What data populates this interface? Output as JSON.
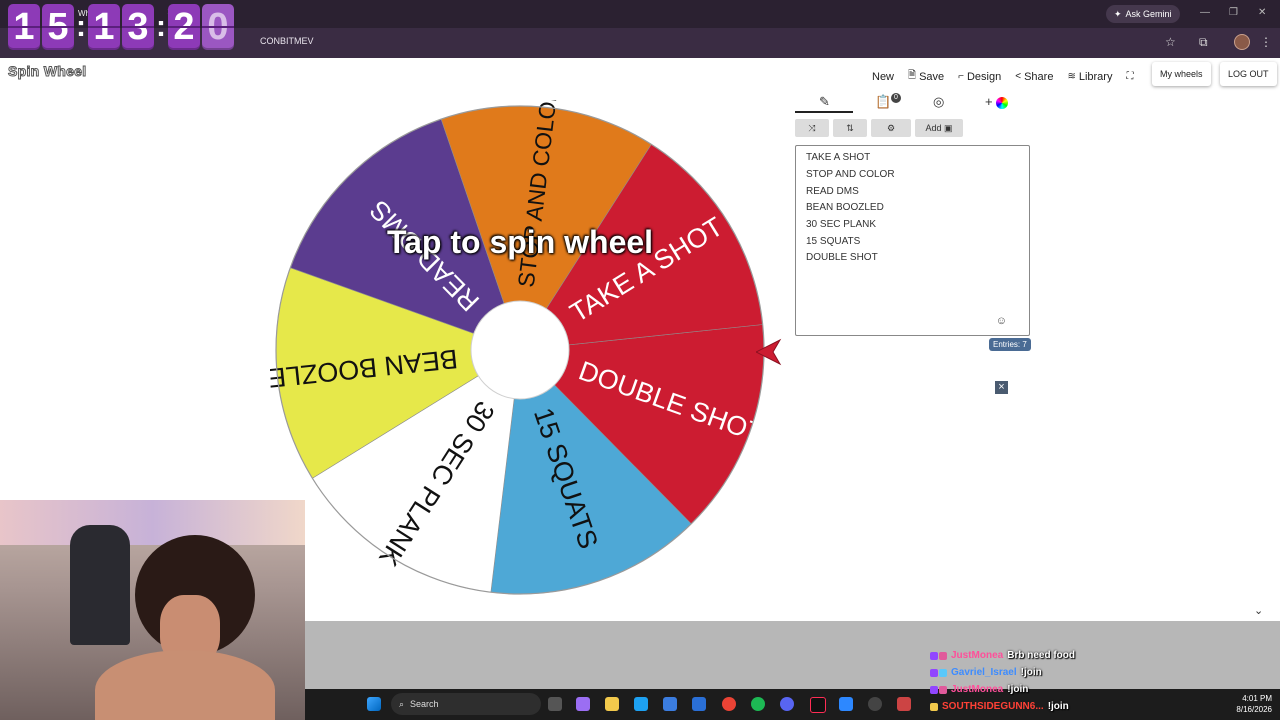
{
  "browser": {
    "tab_title": "Whee",
    "url_fragment": "CONBITMEV",
    "ask_gemini": "Ask Gemini",
    "window_controls": [
      "minimize-icon",
      "restore-icon",
      "close-icon"
    ]
  },
  "timer": {
    "digits": [
      "1",
      "5",
      "1",
      "3",
      "2",
      "0"
    ],
    "separator": ":"
  },
  "app": {
    "logo": "Spin Wheel",
    "nav": [
      {
        "label": "New",
        "icon": ""
      },
      {
        "label": "Save",
        "icon": "save-icon"
      },
      {
        "label": "Design",
        "icon": "design-icon"
      },
      {
        "label": "Share",
        "icon": "share-icon"
      },
      {
        "label": "Library",
        "icon": "library-icon"
      }
    ],
    "fullscreen_icon": "fullscreen-icon",
    "my_wheels": "My wheels",
    "logout": "LOG OUT"
  },
  "wheel": {
    "cta": "Tap to spin wheel",
    "segments": [
      {
        "label": "DOUBLE SHOT",
        "color": "#cc1c31",
        "text_color": "#ffffff"
      },
      {
        "label": "15 SQUATS",
        "color": "#4ea8d6",
        "text_color": "#111111"
      },
      {
        "label": "30 SEC PLANK",
        "color": "#ffffff",
        "text_color": "#111111"
      },
      {
        "label": "BEAN BOOZLED",
        "color": "#e6e84a",
        "text_color": "#111111"
      },
      {
        "label": "READ DMS",
        "color": "#5b3c8f",
        "text_color": "#ffffff"
      },
      {
        "label": "STOP AND COLOR",
        "color": "#e07a1b",
        "text_color": "#111111"
      },
      {
        "label": "TAKE A SHOT",
        "color": "#cc1c31",
        "text_color": "#ffffff"
      }
    ],
    "pointer_color": "#cc1c31"
  },
  "editor": {
    "tabs": [
      "edit-icon",
      "results-icon",
      "hide-icon",
      "add-color-icon"
    ],
    "results_badge": "0",
    "tools": [
      {
        "icon": "shuffle-icon",
        "label": ""
      },
      {
        "icon": "sort-icon",
        "label": ""
      },
      {
        "icon": "settings-icon",
        "label": ""
      },
      {
        "icon": "image-icon",
        "label": "Add"
      }
    ],
    "entries": [
      "TAKE A SHOT",
      "STOP AND COLOR",
      "READ DMS",
      "BEAN BOOZLED",
      "30 SEC PLANK",
      "15 SQUATS",
      "DOUBLE SHOT"
    ],
    "entries_count": "Entries: 7"
  },
  "chat": [
    {
      "user": "JustMonea",
      "user_color": "#ff4f9a",
      "message": "Brb need food"
    },
    {
      "user": "Gavriel_Israel",
      "user_color": "#3d8cff",
      "message": "!join"
    },
    {
      "user": "JustMonea",
      "user_color": "#ff4f9a",
      "message": "!join"
    },
    {
      "user": "SOUTHSIDEGUNN6...",
      "user_color": "#ff4136",
      "message": "!join"
    }
  ],
  "taskbar": {
    "search": "Search",
    "time": "4:01 PM",
    "date": "8/16/2026"
  }
}
